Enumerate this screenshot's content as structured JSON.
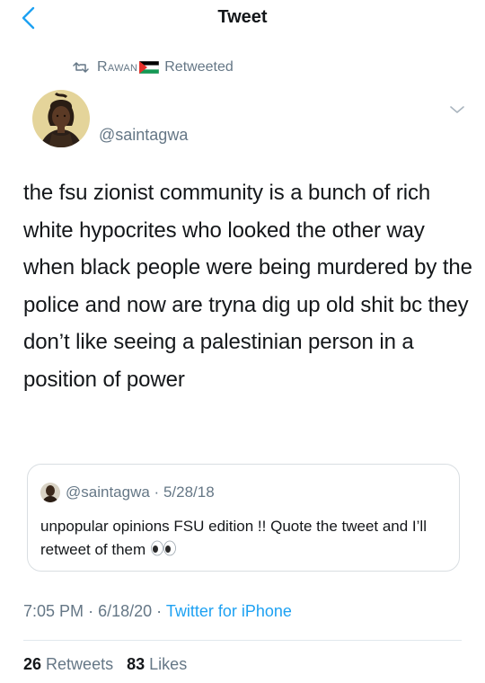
{
  "nav": {
    "title": "Tweet",
    "back_icon": "chevron-left-icon",
    "accent": "#1da1f2"
  },
  "retweet_context": {
    "name": "Rawan",
    "flag": "palestine-flag-icon",
    "label": "Retweeted"
  },
  "tweet": {
    "handle": "@saintagwa",
    "text": "the fsu zionist community is a bunch of rich white hypocrites who looked the other way when black people were being murdered by the police and now are tryna dig up old shit bc they don’t like seeing a palestinian person in a position of power",
    "time": "7:05 PM",
    "date": "6/18/20",
    "separator": "·",
    "source": "Twitter for iPhone"
  },
  "quoted_tweet": {
    "handle": "@saintagwa",
    "separator": "·",
    "date": "5/28/18",
    "text": "unpopular opinions FSU edition !! Quote the tweet and I’ll retweet of them",
    "emoji": "eyes-emoji-icon"
  },
  "stats": {
    "retweets_count": "26",
    "retweets_label": "Retweets",
    "likes_count": "83",
    "likes_label": "Likes"
  },
  "colors": {
    "text_primary": "#14171a",
    "text_secondary": "#657786",
    "link": "#1da1f2",
    "border": "#d9dee2"
  }
}
